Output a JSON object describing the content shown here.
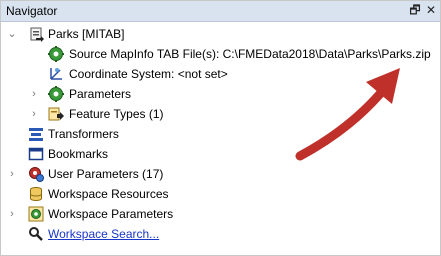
{
  "panel": {
    "title": "Navigator",
    "restore_symbol": "🗗",
    "close_symbol": "✕"
  },
  "tree": {
    "reader_label": "Parks [MITAB]",
    "source_label": "Source MapInfo TAB File(s): C:\\FMEData2018\\Data\\Parks\\Parks.zip",
    "coord_label": "Coordinate System: <not set>",
    "parameters_label": "Parameters",
    "feature_types_label": "Feature Types (1)",
    "transformers_label": "Transformers",
    "bookmarks_label": "Bookmarks",
    "user_params_label": "User Parameters (17)",
    "ws_resources_label": "Workspace Resources",
    "ws_params_label": "Workspace Parameters",
    "ws_search_label": "Workspace Search..."
  },
  "colors": {
    "arrow": "#c0302a",
    "title_bar": "#d9e3f0",
    "link": "#1a36c9"
  }
}
